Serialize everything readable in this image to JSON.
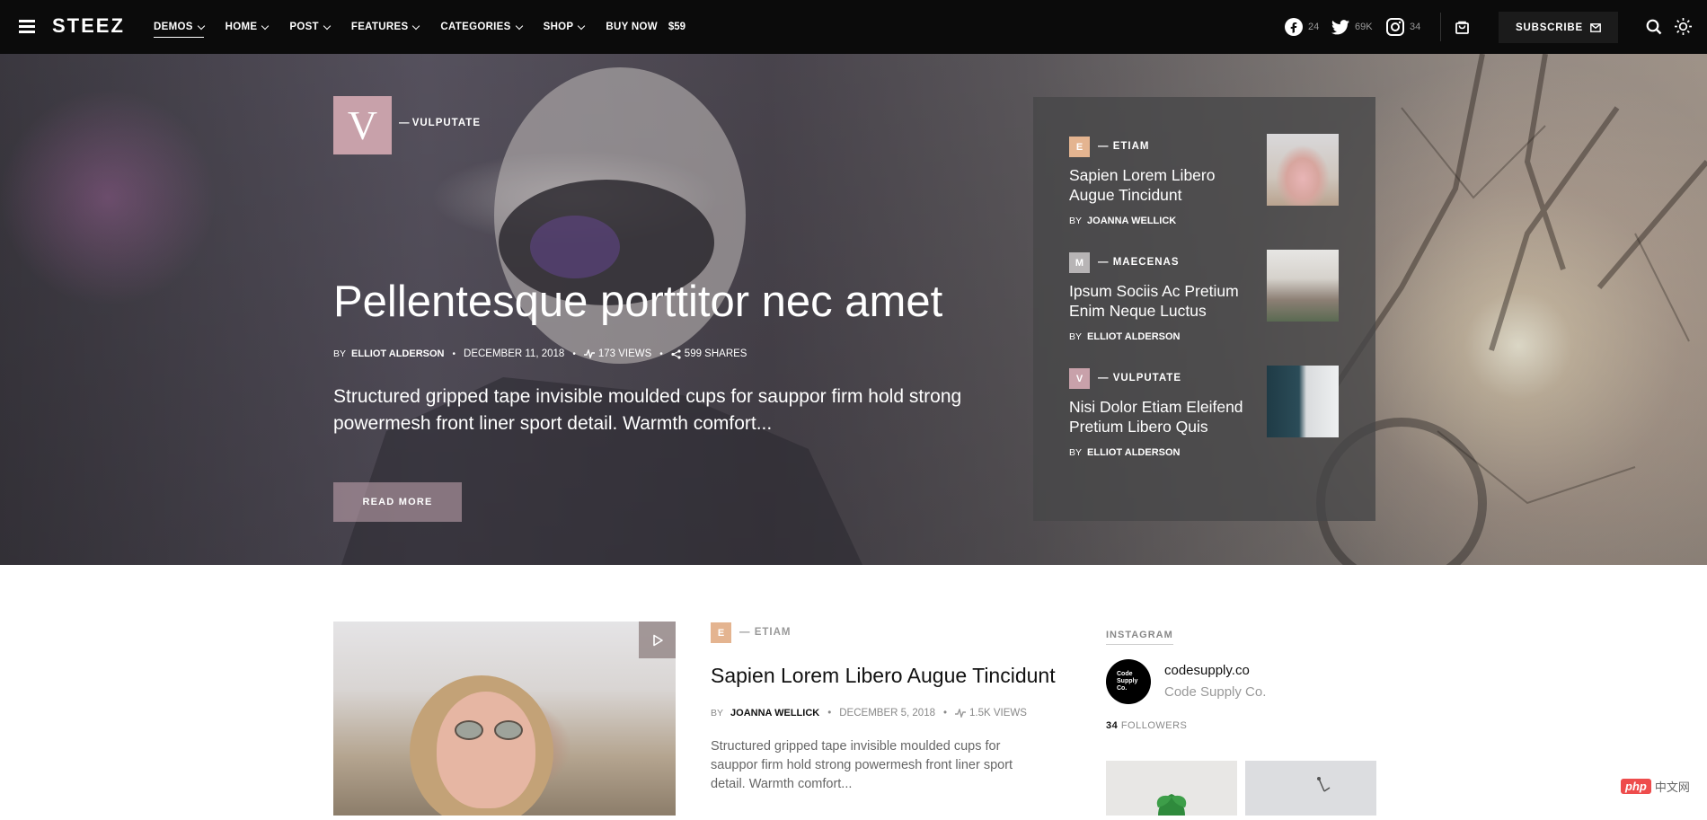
{
  "brand": "STEEZ",
  "nav": {
    "items": [
      {
        "label": "DEMOS",
        "active": true
      },
      {
        "label": "HOME"
      },
      {
        "label": "POST"
      },
      {
        "label": "FEATURES"
      },
      {
        "label": "CATEGORIES"
      },
      {
        "label": "SHOP"
      }
    ],
    "buy_now": "BUY NOW",
    "price": "$59"
  },
  "social": {
    "facebook": "24",
    "twitter": "69K",
    "instagram": "34"
  },
  "subscribe": "SUBSCRIBE",
  "hero": {
    "category_letter": "V",
    "category": "VULPUTATE",
    "title": "Pellentesque porttitor nec amet",
    "by": "BY",
    "author": "ELLIOT ALDERSON",
    "date": "DECEMBER 11, 2018",
    "views": "173 VIEWS",
    "shares": "599 SHARES",
    "excerpt": "Structured gripped tape invisible moulded cups for sauppor firm hold strong powermesh front liner sport detail. Warmth comfort...",
    "read_more": "READ MORE"
  },
  "side_posts": [
    {
      "letter": "E",
      "category": "ETIAM",
      "title": "Sapien Lorem Libero Augue Tincidunt",
      "by": "BY",
      "author": "JOANNA WELLICK",
      "badge_color": "#e4b490"
    },
    {
      "letter": "M",
      "category": "MAECENAS",
      "title": "Ipsum Sociis Ac Pretium Enim Neque Luctus",
      "by": "BY",
      "author": "ELLIOT ALDERSON",
      "badge_color": "#b7b4b5"
    },
    {
      "letter": "V",
      "category": "VULPUTATE",
      "title": "Nisi Dolor Etiam Eleifend Pretium Libero Quis",
      "by": "BY",
      "author": "ELLIOT ALDERSON",
      "badge_color": "#c8a1aa"
    }
  ],
  "post": {
    "letter": "E",
    "category": "ETIAM",
    "title": "Sapien Lorem Libero Augue Tincidunt",
    "by": "BY",
    "author": "JOANNA WELLICK",
    "date": "DECEMBER 5, 2018",
    "views": "1.5K VIEWS",
    "excerpt": "Structured gripped tape invisible moulded cups for sauppor firm hold strong powermesh front liner sport detail. Warmth comfort..."
  },
  "instagram": {
    "label": "INSTAGRAM",
    "avatar_text": "Code Supply Co.",
    "handle": "codesupply.co",
    "name": "Code Supply Co.",
    "followers_count": "34",
    "followers_label": "FOLLOWERS"
  },
  "watermark": {
    "php": "php",
    "cn": "中文网"
  }
}
